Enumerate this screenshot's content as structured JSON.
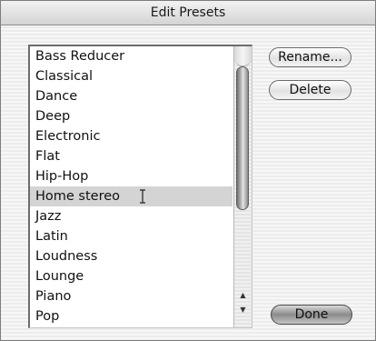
{
  "dialog": {
    "title": "Edit Presets"
  },
  "presets": {
    "items": [
      "Bass Reducer",
      "Classical",
      "Dance",
      "Deep",
      "Electronic",
      "Flat",
      "Hip-Hop",
      "Home stereo",
      "Jazz",
      "Latin",
      "Loudness",
      "Lounge",
      "Piano",
      "Pop"
    ],
    "selected": "Home stereo"
  },
  "buttons": {
    "rename": "Rename...",
    "delete": "Delete",
    "done": "Done"
  },
  "scrollbar": {
    "up_arrow": "▲",
    "down_arrow": "▼"
  }
}
